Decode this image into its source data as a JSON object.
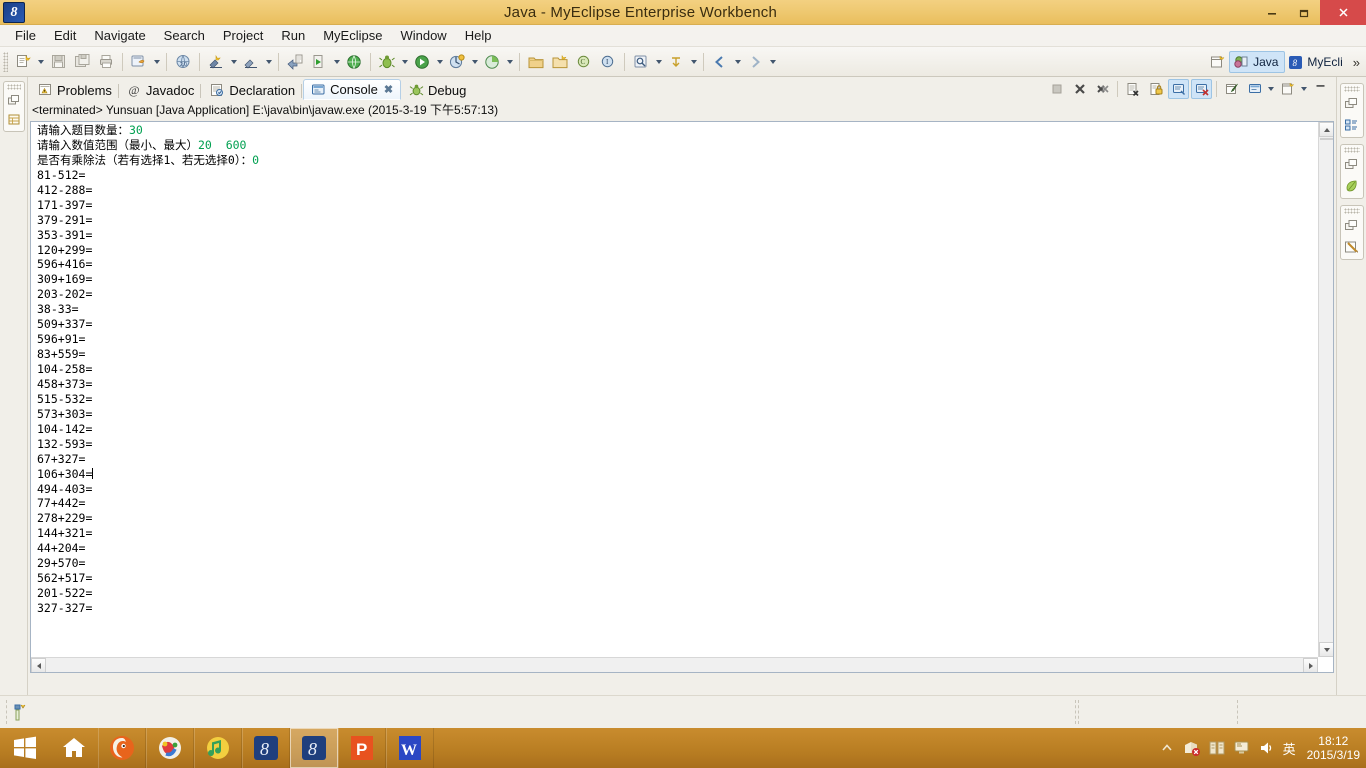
{
  "window": {
    "title": "Java - MyEclipse Enterprise Workbench",
    "app_icon": "myeclipse-icon",
    "minimize_label": "—",
    "restore_label": "❐",
    "close_label": "×"
  },
  "menubar": {
    "items": [
      {
        "label": "File",
        "name": "menu-file"
      },
      {
        "label": "Edit",
        "name": "menu-edit"
      },
      {
        "label": "Navigate",
        "name": "menu-navigate"
      },
      {
        "label": "Search",
        "name": "menu-search"
      },
      {
        "label": "Project",
        "name": "menu-project"
      },
      {
        "label": "Run",
        "name": "menu-run"
      },
      {
        "label": "MyEclipse",
        "name": "menu-myeclipse"
      },
      {
        "label": "Window",
        "name": "menu-window"
      },
      {
        "label": "Help",
        "name": "menu-help"
      }
    ]
  },
  "perspective": {
    "open_label": "open-perspective-icon",
    "active": "Java",
    "secondary": "MyEcli",
    "more": "»"
  },
  "view_tabs": [
    {
      "label": "Problems",
      "icon": "problems-icon",
      "active": false,
      "closable": false
    },
    {
      "label": "Javadoc",
      "icon": "javadoc-at-icon",
      "active": false,
      "closable": false
    },
    {
      "label": "Declaration",
      "icon": "declaration-icon",
      "active": false,
      "closable": false
    },
    {
      "label": "Console",
      "icon": "console-icon",
      "active": true,
      "closable": true
    },
    {
      "label": "Debug",
      "icon": "debug-icon",
      "active": false,
      "closable": false
    }
  ],
  "console": {
    "header": "<terminated> Yunsuan [Java Application] E:\\java\\bin\\javaw.exe (2015-3-19 下午5:57:13)",
    "prompts": [
      {
        "text": "请输入题目数量：",
        "value": "30"
      },
      {
        "text": "请输入数值范围（最小、最大）",
        "value": "20  600"
      },
      {
        "text": "是否有乘除法（若有选择1、若无选择0）：",
        "value": "0"
      }
    ],
    "problems": [
      "81-512=",
      "412-288=",
      "171-397=",
      "379-291=",
      "353-391=",
      "120+299=",
      "596+416=",
      "309+169=",
      "203-202=",
      "38-33=",
      "509+337=",
      "596+91=",
      "83+559=",
      "104-258=",
      "458+373=",
      "515-532=",
      "573+303=",
      "104-142=",
      "132-593=",
      "67+327=",
      "106+304=",
      "494-403=",
      "77+442=",
      "278+229=",
      "144+321=",
      "44+204=",
      "29+570=",
      "562+517=",
      "201-522=",
      "327-327="
    ],
    "caret_line_index": 20,
    "toolbar": [
      {
        "name": "terminate-button",
        "icon": "stop-square-icon",
        "state": "disabled"
      },
      {
        "name": "remove-launch-button",
        "icon": "remove-x-icon",
        "state": "normal"
      },
      {
        "name": "remove-all-terminated-button",
        "icon": "remove-all-x-icon",
        "state": "normal"
      },
      {
        "name": "clear-console-button",
        "icon": "clear-console-icon",
        "state": "normal"
      },
      {
        "name": "scroll-lock-button",
        "icon": "lock-icon",
        "state": "normal"
      },
      {
        "name": "pin-console-button",
        "icon": "pin-console-icon",
        "state": "on"
      },
      {
        "name": "display-selected-console-button",
        "icon": "display-console-icon",
        "state": "on"
      },
      {
        "name": "open-console-button",
        "icon": "open-console-icon",
        "state": "normal"
      },
      {
        "name": "new-console-view-button",
        "icon": "new-console-icon",
        "state": "normal"
      },
      {
        "name": "view-menu-button",
        "icon": "view-menu-icon",
        "state": "normal"
      },
      {
        "name": "minimize-view-button",
        "icon": "minimize-icon",
        "state": "normal"
      }
    ]
  },
  "left_fastview": [
    {
      "name": "fastview-restore-icon",
      "icon": "restore-icon"
    },
    {
      "name": "fastview-package-explorer-icon",
      "icon": "package-explorer-icon"
    }
  ],
  "right_fastview": [
    {
      "name": "fastview-outline-icon",
      "icon": "outline-icon"
    },
    {
      "name": "fastview-nature-icon",
      "icon": "leaf-icon"
    },
    {
      "name": "fastview-tasks-icon",
      "icon": "task-pencil-icon"
    }
  ],
  "taskbar": {
    "start": "windows-start-icon",
    "items": [
      {
        "name": "taskbar-home-icon",
        "icon": "home-icon",
        "active": false
      },
      {
        "name": "taskbar-firefox-icon",
        "icon": "firefox-icon",
        "active": false
      },
      {
        "name": "taskbar-colorapp-icon",
        "icon": "palette-icon",
        "active": false
      },
      {
        "name": "taskbar-music-icon",
        "icon": "music-note-icon",
        "active": false
      },
      {
        "name": "taskbar-myeclipse-icon",
        "icon": "myeclipse-icon",
        "active": false
      },
      {
        "name": "taskbar-myeclipse-active-icon",
        "icon": "myeclipse-icon",
        "active": true
      },
      {
        "name": "taskbar-powerpoint-icon",
        "icon": "powerpoint-icon",
        "active": false
      },
      {
        "name": "taskbar-word-icon",
        "icon": "word-icon",
        "active": false
      }
    ],
    "tray": {
      "expand": "show-hidden-icons-icon",
      "icons": [
        {
          "name": "network-error-icon",
          "glyph": "network-icon"
        },
        {
          "name": "security-icon",
          "glyph": "shield-icon"
        },
        {
          "name": "monitor-icon",
          "glyph": "display-icon"
        },
        {
          "name": "volume-icon",
          "glyph": "speaker-icon"
        }
      ],
      "ime": "英",
      "time": "18:12",
      "date": "2015/3/19"
    }
  },
  "colors": {
    "title_bg": "#eec870",
    "console_value_green": "#00a050",
    "accent_blue": "#cfe4f7",
    "taskbar_bg": "#b87d22",
    "close_red": "#d64a4a"
  }
}
